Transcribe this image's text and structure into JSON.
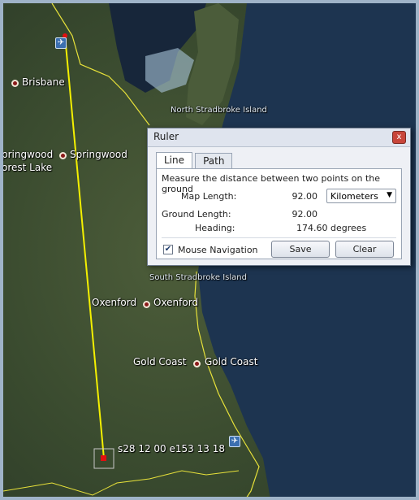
{
  "map": {
    "places": {
      "brisbane": "Brisbane",
      "springwood_left": "pringwood",
      "springwood_right": "Springwood",
      "forest_lake": "orest Lake",
      "north_stradbroke": "North Stradbroke Island",
      "south_stradbroke": "South Stradbroke Island",
      "oxenford_left": "Oxenford",
      "oxenford_right": "Oxenford",
      "gold_coast_left": "Gold Coast",
      "gold_coast_right": "Gold Coast"
    },
    "coordinate_readout": "s28 12 00 e153 13 18",
    "colors": {
      "ruler_line": "#f4f000",
      "coastline": "#e8e23a",
      "water": "#1b2f4a",
      "land": "#3e5233"
    },
    "icons": {
      "airport": "airplane-icon",
      "place": "place-pin-icon"
    }
  },
  "ruler": {
    "title": "Ruler",
    "tabs": [
      "Line",
      "Path"
    ],
    "description": "Measure the distance between two points on the ground",
    "map_length_label": "Map Length:",
    "map_length_value": "92.00",
    "unit_selected": "Kilometers",
    "ground_length_label": "Ground Length:",
    "ground_length_value": "92.00",
    "heading_label": "Heading:",
    "heading_value": "174.60 degrees",
    "mouse_navigation_label": "Mouse Navigation",
    "mouse_navigation_checked": true,
    "save_label": "Save",
    "clear_label": "Clear",
    "close_glyph": "x"
  }
}
